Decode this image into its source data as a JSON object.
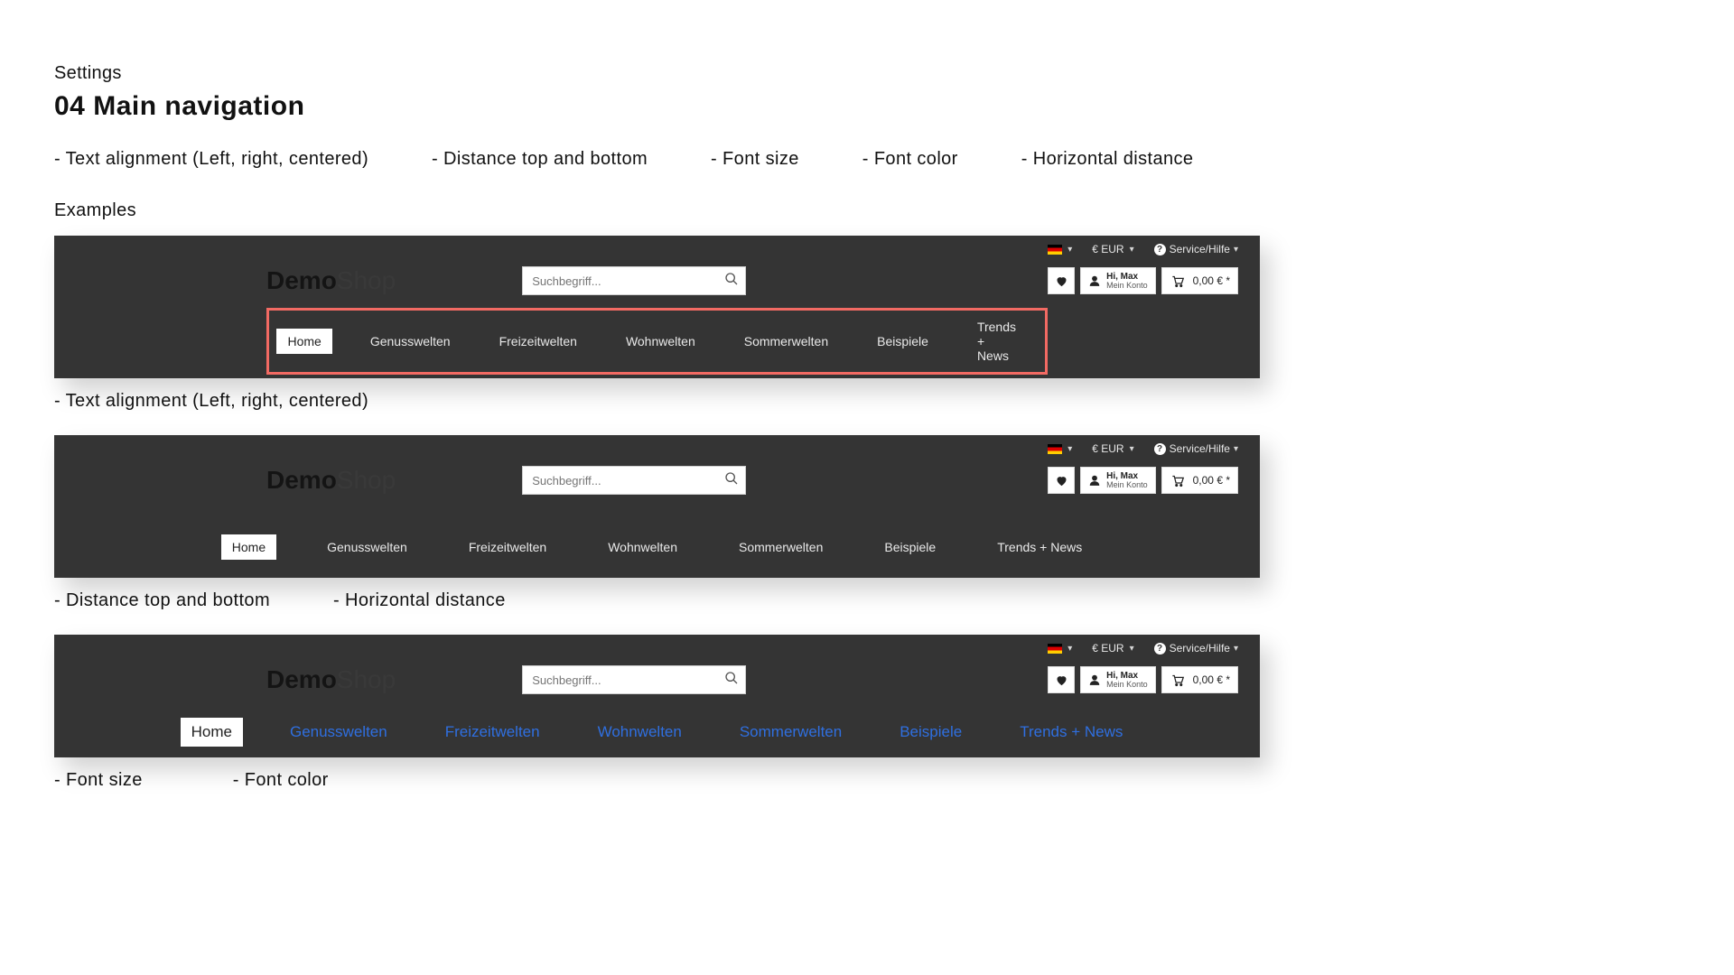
{
  "page": {
    "breadcrumb": "Settings",
    "title": "04 Main navigation",
    "bullets": {
      "b1": "- Text alignment (Left, right, centered)",
      "b2": "- Distance top and bottom",
      "b3": "- Font size",
      "b4": "- Font color",
      "b5": "- Horizontal distance"
    },
    "examples_label": "Examples"
  },
  "header": {
    "logo_bold": "Demo",
    "logo_light": "Shop",
    "search_placeholder": "Suchbegriff...",
    "currency": "€ EUR",
    "service": "Service/Hilfe",
    "account_line1": "Hi, Max",
    "account_line2": "Mein Konto",
    "cart_total": "0,00 € *"
  },
  "nav": {
    "items": {
      "0": "Home",
      "1": "Genusswelten",
      "2": "Freizeitwelten",
      "3": "Wohnwelten",
      "4": "Sommerwelten",
      "5": "Beispiele",
      "6": "Trends + News"
    }
  },
  "captions": {
    "c1": "- Text alignment (Left, right, centered)",
    "c2a": "- Distance top and bottom",
    "c2b": "- Horizontal distance",
    "c3a": "- Font size",
    "c3b": "- Font color"
  }
}
